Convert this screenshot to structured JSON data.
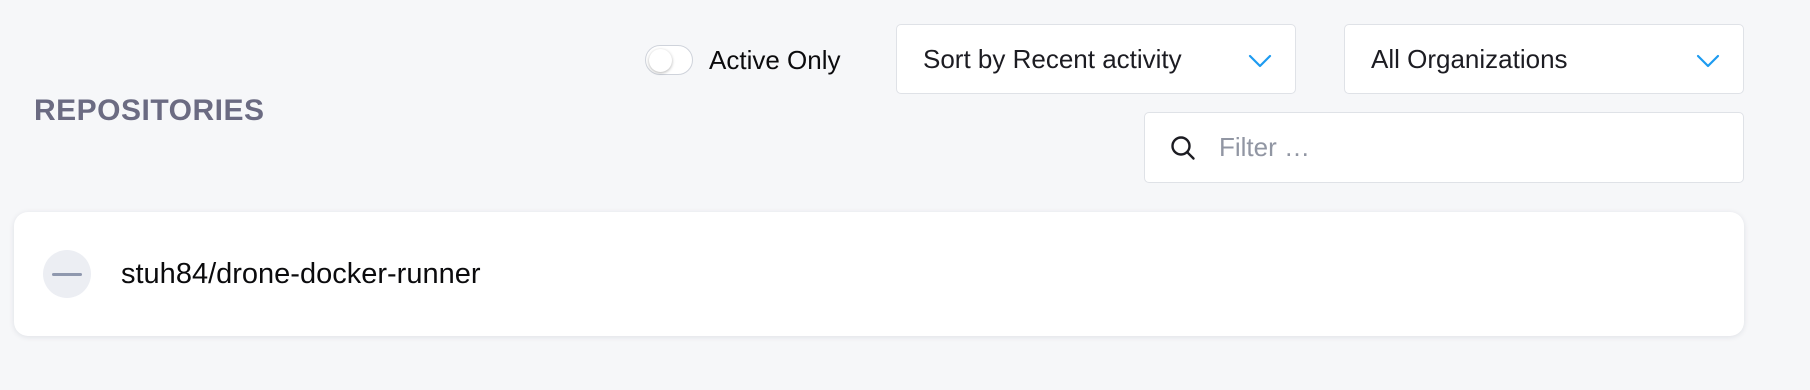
{
  "filters": {
    "active_only": {
      "label": "Active Only",
      "checked": false
    },
    "sort": {
      "value": "Sort by Recent activity",
      "icon": "chevron-down-icon"
    },
    "organization": {
      "value": "All Organizations",
      "icon": "chevron-down-icon"
    },
    "search": {
      "placeholder": "Filter …",
      "value": "",
      "icon": "search-icon"
    }
  },
  "section": {
    "title": "REPOSITORIES"
  },
  "repositories": [
    {
      "name": "stuh84/drone-docker-runner",
      "status_icon": "inactive-dash-icon"
    }
  ],
  "colors": {
    "background": "#f6f7f9",
    "accent": "#1d9bf0",
    "section_title": "#6b6b82"
  }
}
